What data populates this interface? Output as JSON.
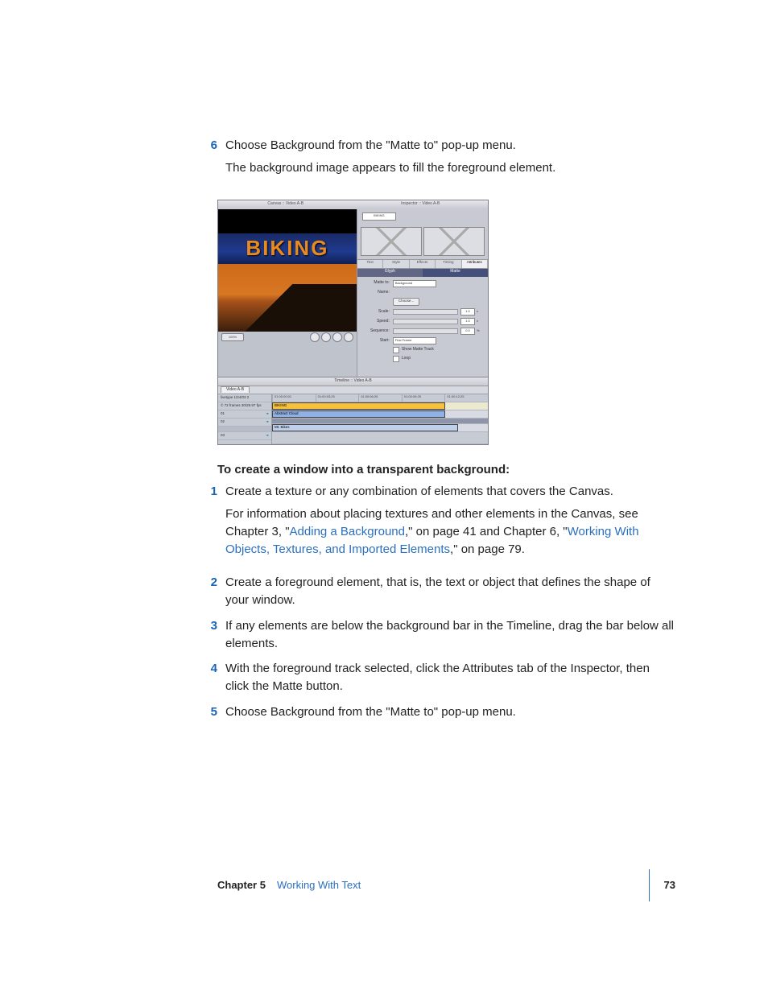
{
  "step6": {
    "num": "6",
    "line1": "Choose Background from the \"Matte to\" pop-up menu.",
    "line2": "The background image appears to fill the foreground element."
  },
  "shot": {
    "canvas_title": "Canvas :: Video A-B",
    "insp_title": "Inspector :: Video A-B",
    "biking": "BIKING",
    "name_field": "BIKING",
    "zoom": "100%",
    "tabs": {
      "t1": "Text",
      "t2": "Style",
      "t3": "Effects",
      "t4": "Timing",
      "t5": "Attributes"
    },
    "hdr2": {
      "a": "Glyph",
      "b": "Matte"
    },
    "matte_to_label": "Matte to:",
    "matte_to_value": "Background",
    "name_label": "Name:",
    "choose_btn": "Choose...",
    "scale_label": "Scale:",
    "scale_val": "1.0",
    "speed_label": "Speed:",
    "speed_val": "1.0",
    "seq_label": "Sequence:",
    "seq_val": "0.0",
    "start_label": "Start:",
    "start_sel": "First Frame",
    "cb1": "Show Matte Track",
    "cb2": "Loop",
    "tl_title": "Timeline :: Video A-B",
    "tl_tab": "Video A-B",
    "ruler": [
      "01:00:00;01",
      "01:00:03;25",
      "01:00:06;25",
      "01:00:09;25",
      "01:00:12;25"
    ],
    "tracks": {
      "proj1": "livetype 1/24/03 2",
      "proj2": "© 72 frames 30/29.97 fps",
      "t1": "01",
      "t2": "02",
      "t3": "03"
    },
    "clips": {
      "c1": "BIKING",
      "c2": "Abstract Cloud",
      "c3": "Mt. Bikes"
    }
  },
  "section_head": "To create a window into a transparent background:",
  "steps": [
    {
      "num": "1",
      "body": "Create a texture or any combination of elements that covers the Canvas.",
      "extra_pre": "For information about placing textures and other elements in the Canvas, see Chapter 3, \"",
      "link1": "Adding a Background",
      "mid1": ",\" on page 41 and Chapter 6, \"",
      "link2": "Working With Objects, Textures, and Imported Elements",
      "post": ",\" on page 79."
    },
    {
      "num": "2",
      "body": "Create a foreground element, that is, the text or object that defines the shape of your window."
    },
    {
      "num": "3",
      "body": "If any elements are below the background bar in the Timeline, drag the bar below all elements."
    },
    {
      "num": "4",
      "body": "With the foreground track selected, click the Attributes tab of the Inspector, then click the Matte button."
    },
    {
      "num": "5",
      "body": "Choose Background from the \"Matte to\" pop-up menu."
    }
  ],
  "footer": {
    "chapter_label": "Chapter 5",
    "chapter_name": "Working With Text",
    "page": "73"
  }
}
